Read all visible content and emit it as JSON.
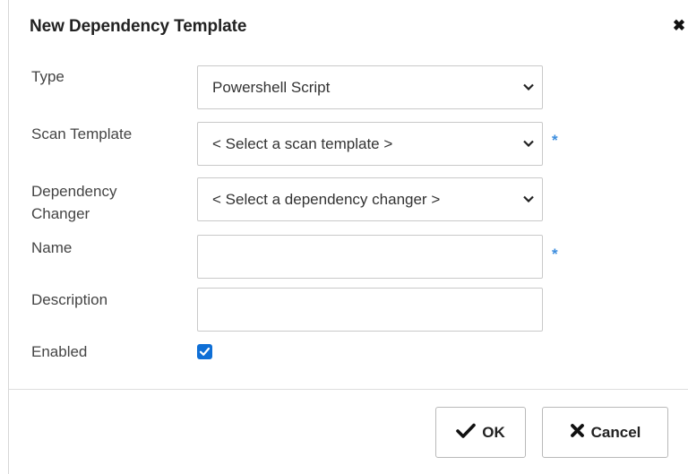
{
  "dialog": {
    "title": "New Dependency Template",
    "close_icon": "close-icon"
  },
  "form": {
    "type": {
      "label": "Type",
      "value": "Powershell Script"
    },
    "scan_template": {
      "label": "Scan Template",
      "value": "< Select a scan template >",
      "required_mark": "*"
    },
    "dependency_changer": {
      "label_line1": "Dependency",
      "label_line2": "Changer",
      "value": "< Select a dependency changer >"
    },
    "name": {
      "label": "Name",
      "value": "",
      "required_mark": "*"
    },
    "description": {
      "label": "Description",
      "value": ""
    },
    "enabled": {
      "label": "Enabled",
      "checked": true
    }
  },
  "footer": {
    "ok_label": "OK",
    "cancel_label": "Cancel",
    "ok_icon": "check-icon",
    "cancel_icon": "times-icon"
  },
  "colors": {
    "accent": "#3c8dde",
    "checkbox": "#0f6fd6"
  }
}
